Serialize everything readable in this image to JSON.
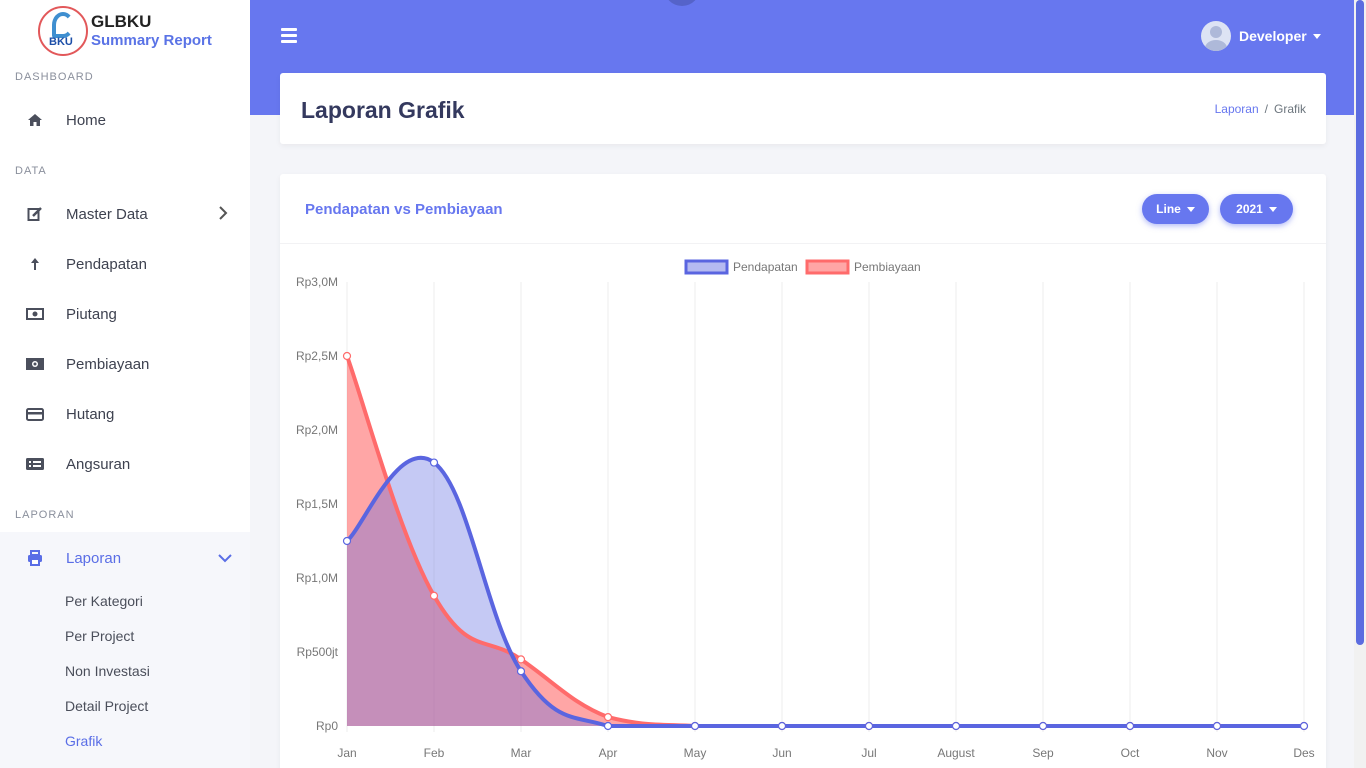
{
  "brand": {
    "title": "GLBKU",
    "subtitle": "Summary Report",
    "logo_text": "BKU"
  },
  "sidebar": {
    "sections": [
      "DASHBOARD",
      "DATA",
      "LAPORAN"
    ],
    "items": [
      {
        "label": "Home",
        "icon": "home-icon"
      },
      {
        "label": "Master Data",
        "icon": "edit-icon"
      },
      {
        "label": "Pendapatan",
        "icon": "arrow-up-icon"
      },
      {
        "label": "Piutang",
        "icon": "money-bill-icon"
      },
      {
        "label": "Pembiayaan",
        "icon": "money-bill-wave-icon"
      },
      {
        "label": "Hutang",
        "icon": "credit-card-icon"
      },
      {
        "label": "Angsuran",
        "icon": "list-card-icon"
      },
      {
        "label": "Laporan",
        "icon": "print-icon"
      }
    ],
    "subitems": [
      "Per Kategori",
      "Per Project",
      "Non Investasi",
      "Detail Project",
      "Grafik"
    ]
  },
  "topbar": {
    "user": "Developer"
  },
  "header": {
    "title": "Laporan Grafik",
    "breadcrumb": [
      "Laporan",
      "Grafik"
    ]
  },
  "card": {
    "title": "Pendapatan vs Pembiayaan",
    "type_button": "Line",
    "year_button": "2021"
  },
  "colors": {
    "accent": "#6777ef",
    "pendapatan": "#5a65e0",
    "pembiayaan": "#ff6b6b"
  },
  "chart_data": {
    "type": "area",
    "categories": [
      "Jan",
      "Feb",
      "Mar",
      "Apr",
      "May",
      "Jun",
      "Jul",
      "August",
      "Sep",
      "Oct",
      "Nov",
      "Des"
    ],
    "ylim": [
      0,
      3000000
    ],
    "y_ticks": [
      {
        "value": 0,
        "label": "Rp0"
      },
      {
        "value": 500000,
        "label": "Rp500jt"
      },
      {
        "value": 1000000,
        "label": "Rp1,0M"
      },
      {
        "value": 1500000,
        "label": "Rp1,5M"
      },
      {
        "value": 2000000,
        "label": "Rp2,0M"
      },
      {
        "value": 2500000,
        "label": "Rp2,5M"
      },
      {
        "value": 3000000,
        "label": "Rp3,0M"
      }
    ],
    "legend_position": "top",
    "grid": true,
    "series": [
      {
        "name": "Pendapatan",
        "values": [
          1250000,
          1780000,
          370000,
          0,
          0,
          0,
          0,
          0,
          0,
          0,
          0,
          0
        ]
      },
      {
        "name": "Pembiayaan",
        "values": [
          2500000,
          880000,
          450000,
          60000,
          0,
          0,
          0,
          0,
          0,
          0,
          0,
          0
        ]
      }
    ]
  }
}
